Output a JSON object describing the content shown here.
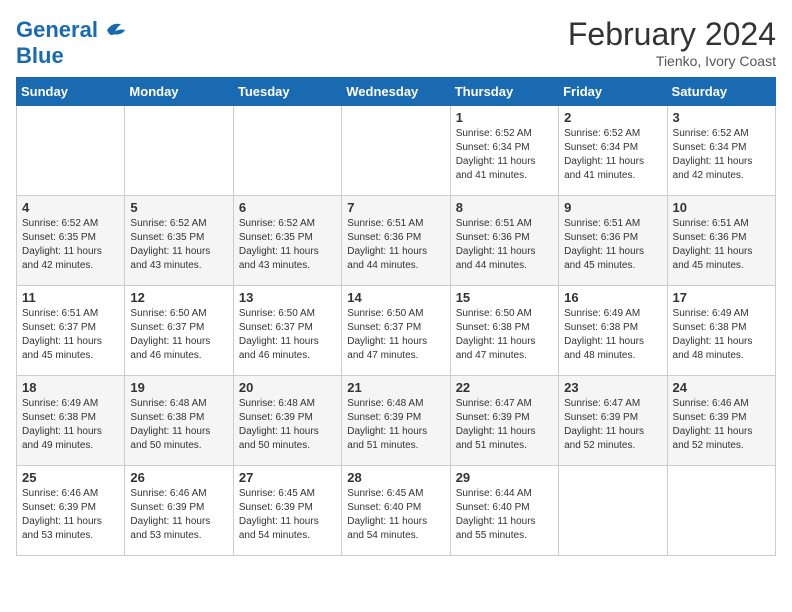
{
  "logo": {
    "line1": "General",
    "line2": "Blue"
  },
  "title": "February 2024",
  "subtitle": "Tienko, Ivory Coast",
  "days_of_week": [
    "Sunday",
    "Monday",
    "Tuesday",
    "Wednesday",
    "Thursday",
    "Friday",
    "Saturday"
  ],
  "weeks": [
    [
      {
        "day": "",
        "info": ""
      },
      {
        "day": "",
        "info": ""
      },
      {
        "day": "",
        "info": ""
      },
      {
        "day": "",
        "info": ""
      },
      {
        "day": "1",
        "info": "Sunrise: 6:52 AM\nSunset: 6:34 PM\nDaylight: 11 hours and 41 minutes."
      },
      {
        "day": "2",
        "info": "Sunrise: 6:52 AM\nSunset: 6:34 PM\nDaylight: 11 hours and 41 minutes."
      },
      {
        "day": "3",
        "info": "Sunrise: 6:52 AM\nSunset: 6:34 PM\nDaylight: 11 hours and 42 minutes."
      }
    ],
    [
      {
        "day": "4",
        "info": "Sunrise: 6:52 AM\nSunset: 6:35 PM\nDaylight: 11 hours and 42 minutes."
      },
      {
        "day": "5",
        "info": "Sunrise: 6:52 AM\nSunset: 6:35 PM\nDaylight: 11 hours and 43 minutes."
      },
      {
        "day": "6",
        "info": "Sunrise: 6:52 AM\nSunset: 6:35 PM\nDaylight: 11 hours and 43 minutes."
      },
      {
        "day": "7",
        "info": "Sunrise: 6:51 AM\nSunset: 6:36 PM\nDaylight: 11 hours and 44 minutes."
      },
      {
        "day": "8",
        "info": "Sunrise: 6:51 AM\nSunset: 6:36 PM\nDaylight: 11 hours and 44 minutes."
      },
      {
        "day": "9",
        "info": "Sunrise: 6:51 AM\nSunset: 6:36 PM\nDaylight: 11 hours and 45 minutes."
      },
      {
        "day": "10",
        "info": "Sunrise: 6:51 AM\nSunset: 6:36 PM\nDaylight: 11 hours and 45 minutes."
      }
    ],
    [
      {
        "day": "11",
        "info": "Sunrise: 6:51 AM\nSunset: 6:37 PM\nDaylight: 11 hours and 45 minutes."
      },
      {
        "day": "12",
        "info": "Sunrise: 6:50 AM\nSunset: 6:37 PM\nDaylight: 11 hours and 46 minutes."
      },
      {
        "day": "13",
        "info": "Sunrise: 6:50 AM\nSunset: 6:37 PM\nDaylight: 11 hours and 46 minutes."
      },
      {
        "day": "14",
        "info": "Sunrise: 6:50 AM\nSunset: 6:37 PM\nDaylight: 11 hours and 47 minutes."
      },
      {
        "day": "15",
        "info": "Sunrise: 6:50 AM\nSunset: 6:38 PM\nDaylight: 11 hours and 47 minutes."
      },
      {
        "day": "16",
        "info": "Sunrise: 6:49 AM\nSunset: 6:38 PM\nDaylight: 11 hours and 48 minutes."
      },
      {
        "day": "17",
        "info": "Sunrise: 6:49 AM\nSunset: 6:38 PM\nDaylight: 11 hours and 48 minutes."
      }
    ],
    [
      {
        "day": "18",
        "info": "Sunrise: 6:49 AM\nSunset: 6:38 PM\nDaylight: 11 hours and 49 minutes."
      },
      {
        "day": "19",
        "info": "Sunrise: 6:48 AM\nSunset: 6:38 PM\nDaylight: 11 hours and 50 minutes."
      },
      {
        "day": "20",
        "info": "Sunrise: 6:48 AM\nSunset: 6:39 PM\nDaylight: 11 hours and 50 minutes."
      },
      {
        "day": "21",
        "info": "Sunrise: 6:48 AM\nSunset: 6:39 PM\nDaylight: 11 hours and 51 minutes."
      },
      {
        "day": "22",
        "info": "Sunrise: 6:47 AM\nSunset: 6:39 PM\nDaylight: 11 hours and 51 minutes."
      },
      {
        "day": "23",
        "info": "Sunrise: 6:47 AM\nSunset: 6:39 PM\nDaylight: 11 hours and 52 minutes."
      },
      {
        "day": "24",
        "info": "Sunrise: 6:46 AM\nSunset: 6:39 PM\nDaylight: 11 hours and 52 minutes."
      }
    ],
    [
      {
        "day": "25",
        "info": "Sunrise: 6:46 AM\nSunset: 6:39 PM\nDaylight: 11 hours and 53 minutes."
      },
      {
        "day": "26",
        "info": "Sunrise: 6:46 AM\nSunset: 6:39 PM\nDaylight: 11 hours and 53 minutes."
      },
      {
        "day": "27",
        "info": "Sunrise: 6:45 AM\nSunset: 6:39 PM\nDaylight: 11 hours and 54 minutes."
      },
      {
        "day": "28",
        "info": "Sunrise: 6:45 AM\nSunset: 6:40 PM\nDaylight: 11 hours and 54 minutes."
      },
      {
        "day": "29",
        "info": "Sunrise: 6:44 AM\nSunset: 6:40 PM\nDaylight: 11 hours and 55 minutes."
      },
      {
        "day": "",
        "info": ""
      },
      {
        "day": "",
        "info": ""
      }
    ]
  ]
}
